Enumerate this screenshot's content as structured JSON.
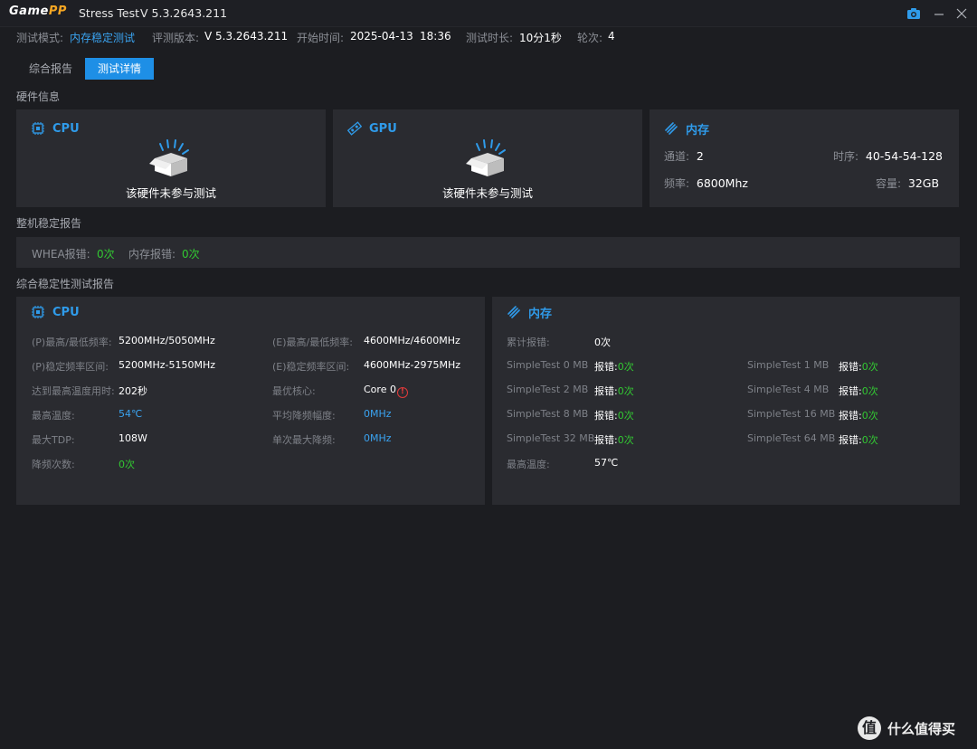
{
  "titlebar": {
    "logo_part1": "Game",
    "logo_part2": "PP",
    "app_name": "Stress Test",
    "version": "V 5.3.2643.211"
  },
  "info": {
    "mode_label": "测试模式:",
    "mode_value": "内存稳定测试",
    "eval_label": "评测版本:",
    "eval_value": "V 5.3.2643.211",
    "start_label": "开始时间:",
    "start_date": "2025-04-13",
    "start_time": "18:36",
    "duration_label": "测试时长:",
    "duration_value": "10分1秒",
    "rounds_label": "轮次:",
    "rounds_value": "4"
  },
  "tabs": [
    {
      "label": "综合报告"
    },
    {
      "label": "测试详情"
    }
  ],
  "hardware": {
    "title": "硬件信息",
    "cpu": {
      "name": "CPU",
      "status": "该硬件未参与测试"
    },
    "gpu": {
      "name": "GPU",
      "status": "该硬件未参与测试"
    },
    "memory": {
      "name": "内存",
      "channel_label": "通道:",
      "channel_value": "2",
      "timing_label": "时序:",
      "timing_value": "40-54-54-128",
      "freq_label": "频率:",
      "freq_value": "6800Mhz",
      "capacity_label": "容量:",
      "capacity_value": "32GB"
    }
  },
  "stability": {
    "title": "整机稳定报告",
    "whea_label": "WHEA报错:",
    "whea_value": "0次",
    "mem_err_label": "内存报错:",
    "mem_err_value": "0次"
  },
  "report": {
    "title": "综合稳定性测试报告",
    "cpu": {
      "name": "CPU",
      "left": [
        {
          "label": "(P)最高/最低频率:",
          "value": "5200MHz/5050MHz"
        },
        {
          "label": "(P)稳定频率区间:",
          "value": "5200MHz-5150MHz"
        },
        {
          "label": "达到最高温度用时:",
          "value": "202秒"
        },
        {
          "label": "最高温度:",
          "value": "54℃"
        },
        {
          "label": "最大TDP:",
          "value": "108W"
        },
        {
          "label": "降频次数:",
          "value": "0次"
        }
      ],
      "right": [
        {
          "label": "(E)最高/最低频率:",
          "value": "4600MHz/4600MHz"
        },
        {
          "label": "(E)稳定频率区间:",
          "value": "4600MHz-2975MHz"
        },
        {
          "label": "最优核心:",
          "value": "Core 0"
        },
        {
          "label": "平均降频幅度:",
          "value": "0MHz"
        },
        {
          "label": "单次最大降频:",
          "value": "0MHz"
        }
      ],
      "warn_symbol": "!"
    },
    "memory": {
      "name": "内存",
      "total_err_label": "累计报错:",
      "total_err_value": "0次",
      "err_label": "报错:",
      "tests": [
        {
          "name": "SimpleTest 0 MB",
          "value": "0次"
        },
        {
          "name": "SimpleTest 1 MB",
          "value": "0次"
        },
        {
          "name": "SimpleTest 2 MB",
          "value": "0次"
        },
        {
          "name": "SimpleTest 4 MB",
          "value": "0次"
        },
        {
          "name": "SimpleTest 8 MB",
          "value": "0次"
        },
        {
          "name": "SimpleTest 16 MB",
          "value": "0次"
        },
        {
          "name": "SimpleTest 32 MB",
          "value": "0次"
        },
        {
          "name": "SimpleTest 64 MB",
          "value": "0次"
        }
      ],
      "max_temp_label": "最高温度:",
      "max_temp_value": "57℃"
    }
  },
  "watermark": {
    "symbol": "值",
    "text": "什么值得买"
  },
  "colors": {
    "accent": "#1e8fe6",
    "ok": "#32c832",
    "warn": "#e03a3a"
  }
}
